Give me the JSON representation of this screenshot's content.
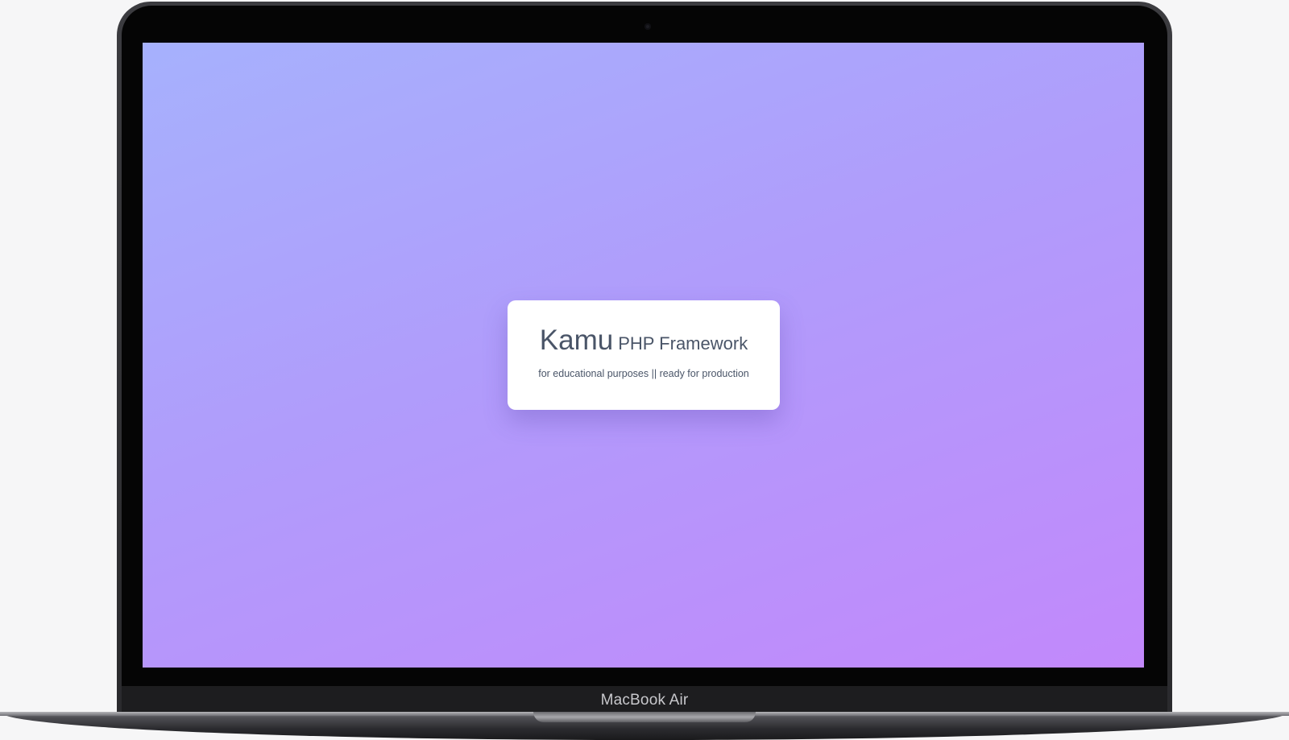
{
  "device": {
    "model_label": "MacBook Air"
  },
  "page": {
    "brand": "Kamu",
    "product": "PHP Framework",
    "tagline": "for educational purposes || ready for production"
  },
  "colors": {
    "gradient_start": "#a6b1fd",
    "gradient_end": "#c288fb",
    "card_bg": "#ffffff",
    "text": "#4a5568"
  }
}
